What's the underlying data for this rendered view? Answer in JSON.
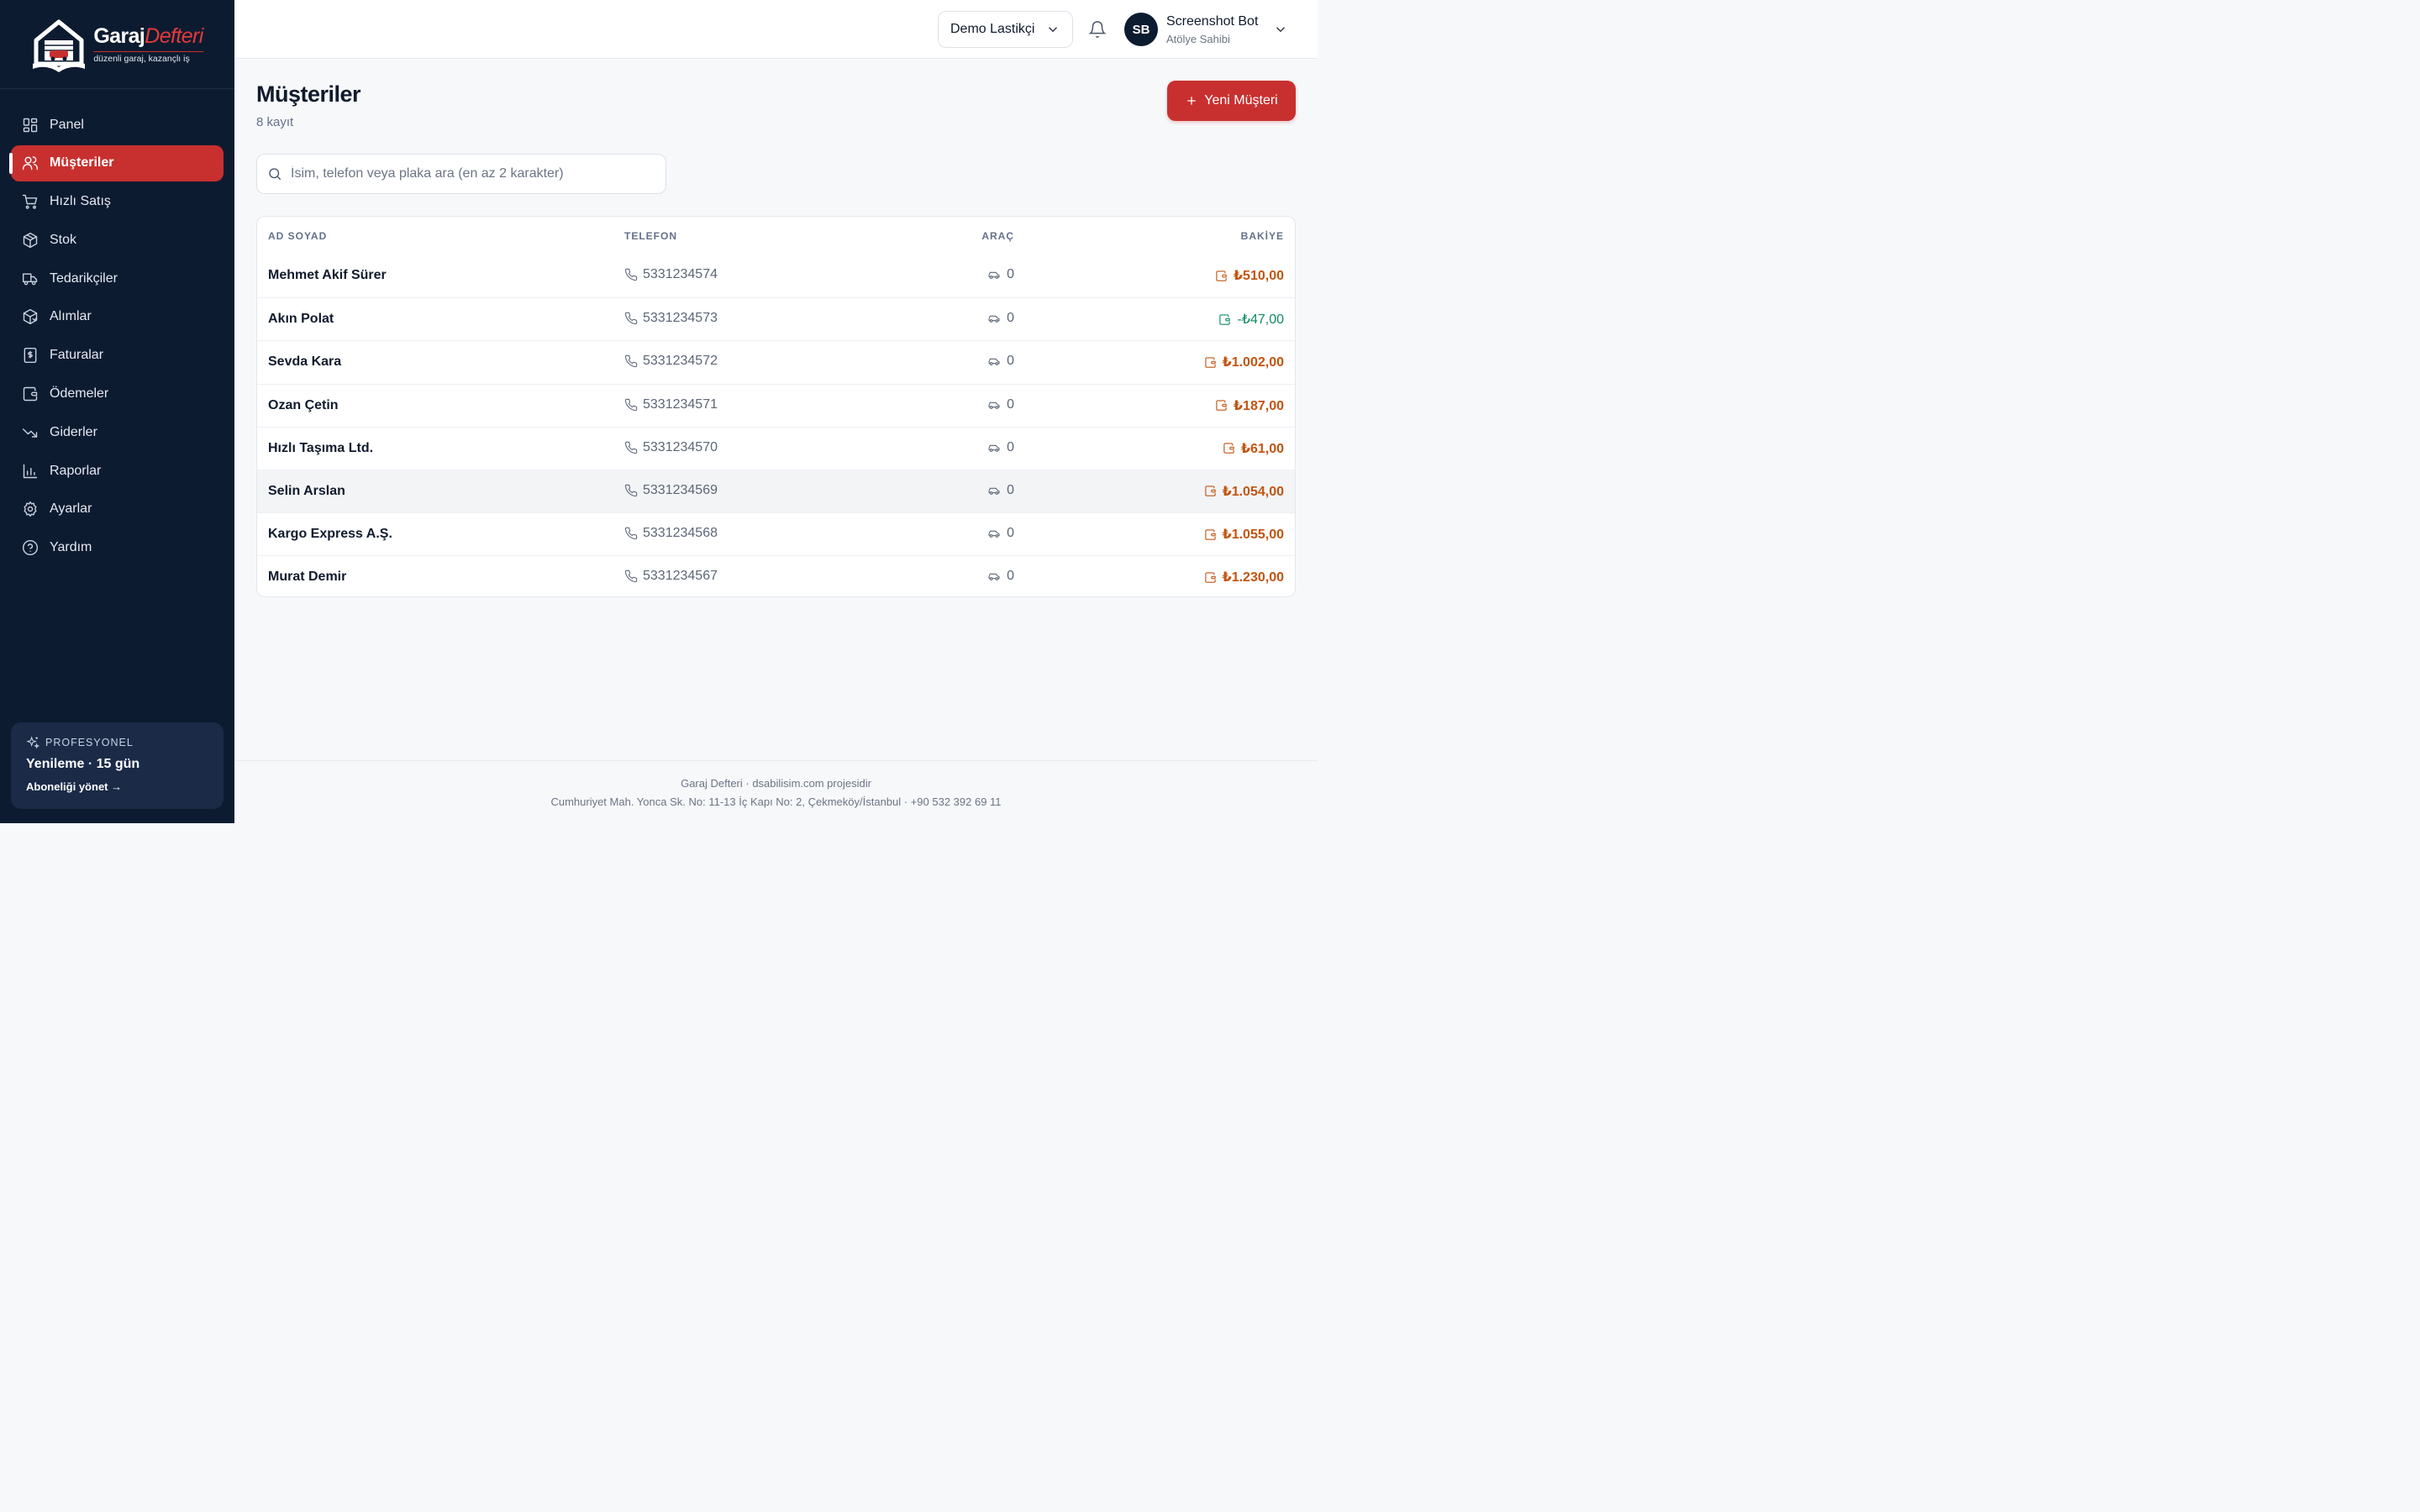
{
  "brand": {
    "name_part1": "Garaj",
    "name_part2": "Defteri",
    "tagline": "düzenli garaj, kazançlı iş"
  },
  "sidebar": {
    "items": [
      {
        "label": "Panel",
        "icon": "dashboard-icon",
        "active": false
      },
      {
        "label": "Müşteriler",
        "icon": "users-icon",
        "active": true
      },
      {
        "label": "Hızlı Satış",
        "icon": "cart-icon",
        "active": false
      },
      {
        "label": "Stok",
        "icon": "box-icon",
        "active": false
      },
      {
        "label": "Tedarikçiler",
        "icon": "truck-icon",
        "active": false
      },
      {
        "label": "Alımlar",
        "icon": "package-icon",
        "active": false
      },
      {
        "label": "Faturalar",
        "icon": "invoice-icon",
        "active": false
      },
      {
        "label": "Ödemeler",
        "icon": "wallet-icon",
        "active": false
      },
      {
        "label": "Giderler",
        "icon": "trend-down-icon",
        "active": false
      },
      {
        "label": "Raporlar",
        "icon": "bar-chart-icon",
        "active": false
      },
      {
        "label": "Ayarlar",
        "icon": "gear-icon",
        "active": false
      },
      {
        "label": "Yardım",
        "icon": "help-icon",
        "active": false
      }
    ]
  },
  "plan": {
    "label": "PROFESYONEL",
    "title": "Yenileme · 15 gün",
    "link": "Aboneliği yönet →"
  },
  "header": {
    "tenant": "Demo Lastikçi",
    "user_initials": "SB",
    "user_name": "Screenshot Bot",
    "user_role": "Atölye Sahibi"
  },
  "page": {
    "title": "Müşteriler",
    "subtitle": "8 kayıt",
    "new_button": "Yeni Müşteri",
    "search_placeholder": "İsim, telefon veya plaka ara (en az 2 karakter)"
  },
  "table": {
    "headers": {
      "name": "AD SOYAD",
      "phone": "TELEFON",
      "vehicles": "ARAÇ",
      "balance": "BAKİYE"
    },
    "rows": [
      {
        "name": "Mehmet Akif Sürer",
        "phone": "5331234574",
        "vehicles": "0",
        "balance": "₺510,00",
        "type": "debt"
      },
      {
        "name": "Akın Polat",
        "phone": "5331234573",
        "vehicles": "0",
        "balance": "-₺47,00",
        "type": "credit"
      },
      {
        "name": "Sevda Kara",
        "phone": "5331234572",
        "vehicles": "0",
        "balance": "₺1.002,00",
        "type": "debt"
      },
      {
        "name": "Ozan Çetin",
        "phone": "5331234571",
        "vehicles": "0",
        "balance": "₺187,00",
        "type": "debt"
      },
      {
        "name": "Hızlı Taşıma Ltd.",
        "phone": "5331234570",
        "vehicles": "0",
        "balance": "₺61,00",
        "type": "debt"
      },
      {
        "name": "Selin Arslan",
        "phone": "5331234569",
        "vehicles": "0",
        "balance": "₺1.054,00",
        "type": "debt"
      },
      {
        "name": "Kargo Express A.Ş.",
        "phone": "5331234568",
        "vehicles": "0",
        "balance": "₺1.055,00",
        "type": "debt"
      },
      {
        "name": "Murat Demir",
        "phone": "5331234567",
        "vehicles": "0",
        "balance": "₺1.230,00",
        "type": "debt"
      }
    ]
  },
  "footer": {
    "line1": "Garaj Defteri · dsabilisim.com projesidir",
    "line2": "Cumhuriyet Mah. Yonca Sk. No: 11-13 İç Kapı No: 2, Çekmeköy/İstanbul · +90 532 392 69 11"
  },
  "colors": {
    "sidebar_bg": "#0d1b30",
    "accent": "#c8302f",
    "debt": "#c2540f",
    "credit": "#138a63"
  }
}
